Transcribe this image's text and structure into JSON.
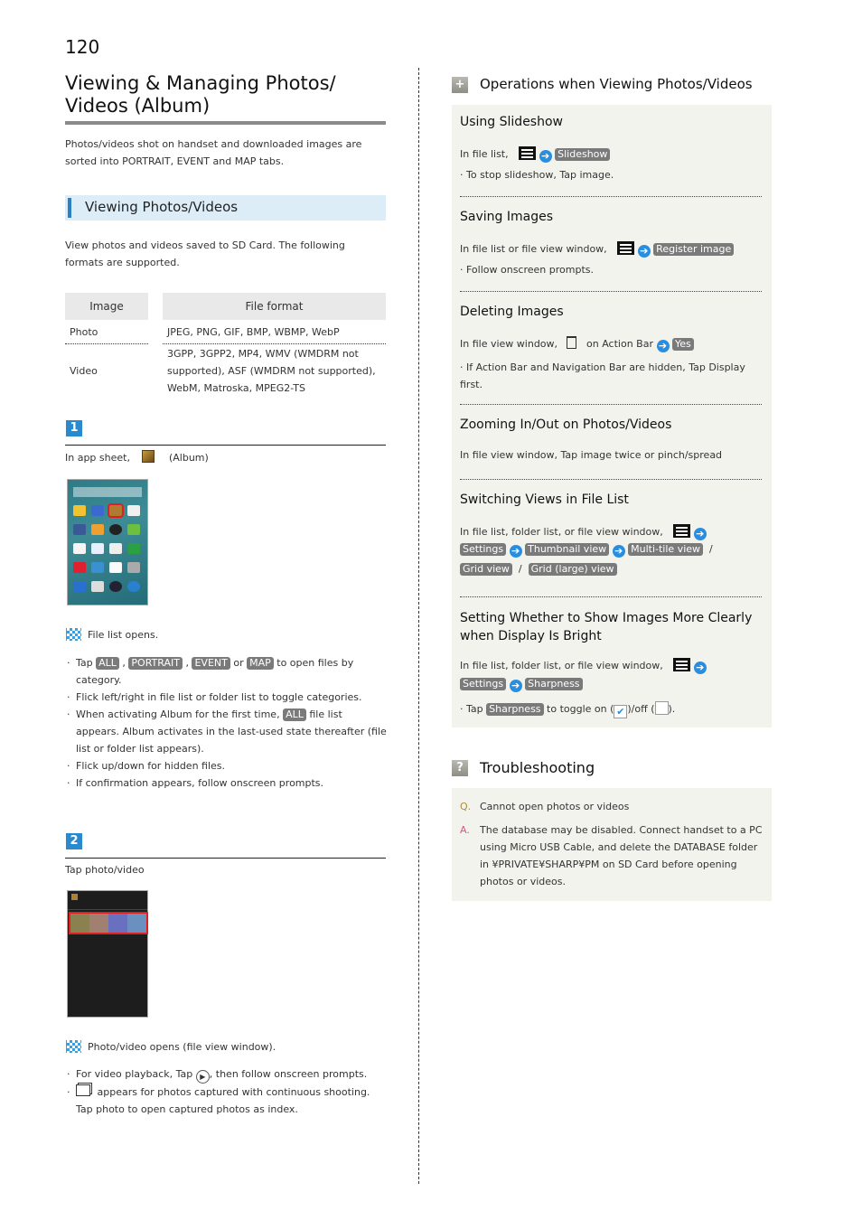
{
  "page_number": "120",
  "title": "Viewing & Managing Photos/ Videos (Album)",
  "intro": "Photos/videos shot on handset and downloaded images are sorted into PORTRAIT, EVENT and MAP tabs.",
  "section_viewing": {
    "heading": "Viewing Photos/Videos",
    "description": "View photos and videos saved to SD Card. The following formats are supported.",
    "table": {
      "headers": [
        "Image",
        "File format"
      ],
      "rows": [
        {
          "image": "Photo",
          "formats": "JPEG, PNG, GIF, BMP, WBMP, WebP"
        },
        {
          "image": "Video",
          "formats": "3GPP, 3GPP2, MP4, WMV (WMDRM not supported), ASF (WMDRM not supported), WebM, Matroska, MPEG2-TS"
        }
      ]
    }
  },
  "steps": [
    {
      "number": "1",
      "instruction_prefix": "In app sheet,",
      "instruction_suffix": "(Album)",
      "result": "File list opens.",
      "notes": {
        "tap": "Tap",
        "tabs": [
          "ALL",
          "PORTRAIT",
          "EVENT",
          "MAP"
        ],
        "or": "or",
        "tap_suffix": "to open files by category.",
        "flick_lr": "Flick left/right in file list or folder list to toggle categories.",
        "first_time_prefix": "When activating Album for the first time,",
        "first_time_pill": "ALL",
        "first_time_suffix": "file list appears. Album activates in the last-used state thereafter (file list or folder list appears).",
        "flick_ud": "Flick up/down for hidden files.",
        "confirm": "If confirmation appears, follow onscreen prompts."
      }
    },
    {
      "number": "2",
      "instruction": "Tap photo/video",
      "result": "Photo/video opens (file view window).",
      "note_video_prefix": "For video playback, Tap",
      "note_video_suffix": ", then follow onscreen prompts.",
      "note_burst_1": "appears for photos captured with continuous shooting.",
      "note_burst_2": "Tap photo to open captured photos as index."
    }
  ],
  "operations": {
    "heading": "Operations when Viewing Photos/Videos",
    "slideshow": {
      "title": "Using Slideshow",
      "prefix": "In file list,",
      "pill": "Slideshow",
      "note": "To stop slideshow, Tap image."
    },
    "saving": {
      "title": "Saving Images",
      "prefix": "In file list or file view window,",
      "pill": "Register image",
      "note": "Follow onscreen prompts."
    },
    "deleting": {
      "title": "Deleting Images",
      "prefix": "In file view window,",
      "middle": "on Action Bar",
      "pill": "Yes",
      "note": "If Action Bar and Navigation Bar are hidden, Tap Display first."
    },
    "zooming": {
      "title": "Zooming In/Out on Photos/Videos",
      "text": "In file view window, Tap image twice or pinch/spread"
    },
    "switching": {
      "title": "Switching Views in File List",
      "prefix": "In file list, folder list, or file view window,",
      "pills": [
        "Settings",
        "Thumbnail view",
        "Multi-tile view",
        "Grid view",
        "Grid (large) view"
      ],
      "sep": "/"
    },
    "sharpness": {
      "title": "Setting Whether to Show Images More Clearly when Display Is Bright",
      "prefix": "In file list, folder list, or file view window,",
      "pills": [
        "Settings",
        "Sharpness"
      ],
      "note_prefix": "Tap",
      "note_pill": "Sharpness",
      "note_mid": "to toggle on (",
      "note_mid2": ")/off (",
      "note_end": ")."
    }
  },
  "troubleshooting": {
    "heading": "Troubleshooting",
    "q_label": "Q.",
    "question": "Cannot open photos or videos",
    "a_label": "A.",
    "answer": "The database may be disabled. Connect handset to a PC using Micro USB Cable, and delete the DATABASE folder in ¥PRIVATE¥SHARP¥PM on SD Card before opening photos or videos."
  },
  "colors": {
    "accent_blue": "#2a8ad0",
    "pill_gray": "#7a7a7a",
    "panel_bg": "#f3f3ee",
    "section_bg": "#dcedf8",
    "q_color": "#b08a3a",
    "a_color": "#e0508a"
  }
}
